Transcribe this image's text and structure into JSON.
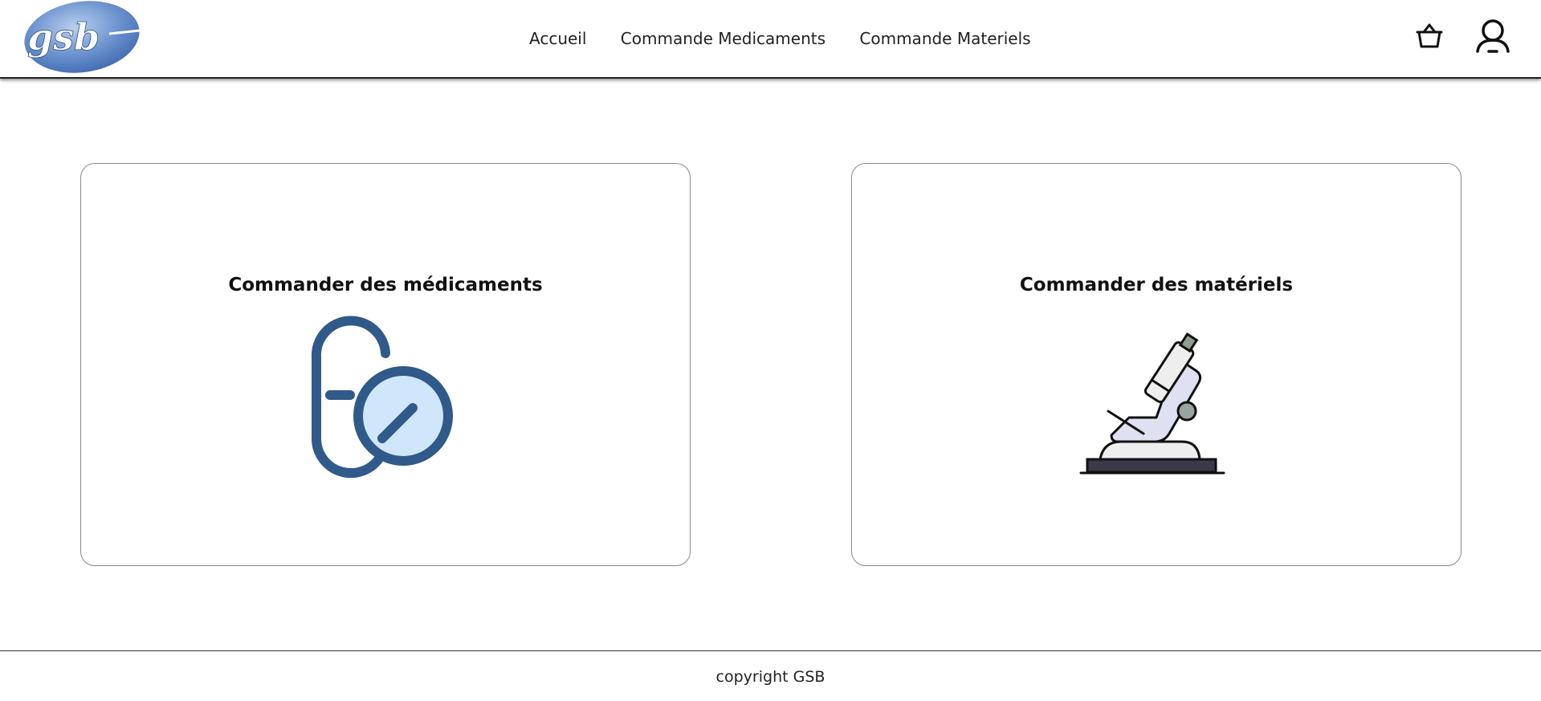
{
  "header": {
    "logo_text": "gsb",
    "nav": [
      {
        "label": "Accueil"
      },
      {
        "label": "Commande Medicaments"
      },
      {
        "label": "Commande Materiels"
      }
    ],
    "cart_icon": "basket-icon",
    "user_icon": "user-icon"
  },
  "main": {
    "cards": [
      {
        "title": "Commander des médicaments",
        "icon": "pill-capsule-icon"
      },
      {
        "title": "Commander des matériels",
        "icon": "microscope-icon"
      }
    ]
  },
  "footer": {
    "text": "copyright GSB"
  },
  "colors": {
    "logo_blue": "#5a86c6",
    "pill_stroke": "#2f5a8a",
    "pill_fill": "#d0e6fa",
    "microscope_body": "#dfe1f2",
    "microscope_base": "#3a3a48"
  }
}
